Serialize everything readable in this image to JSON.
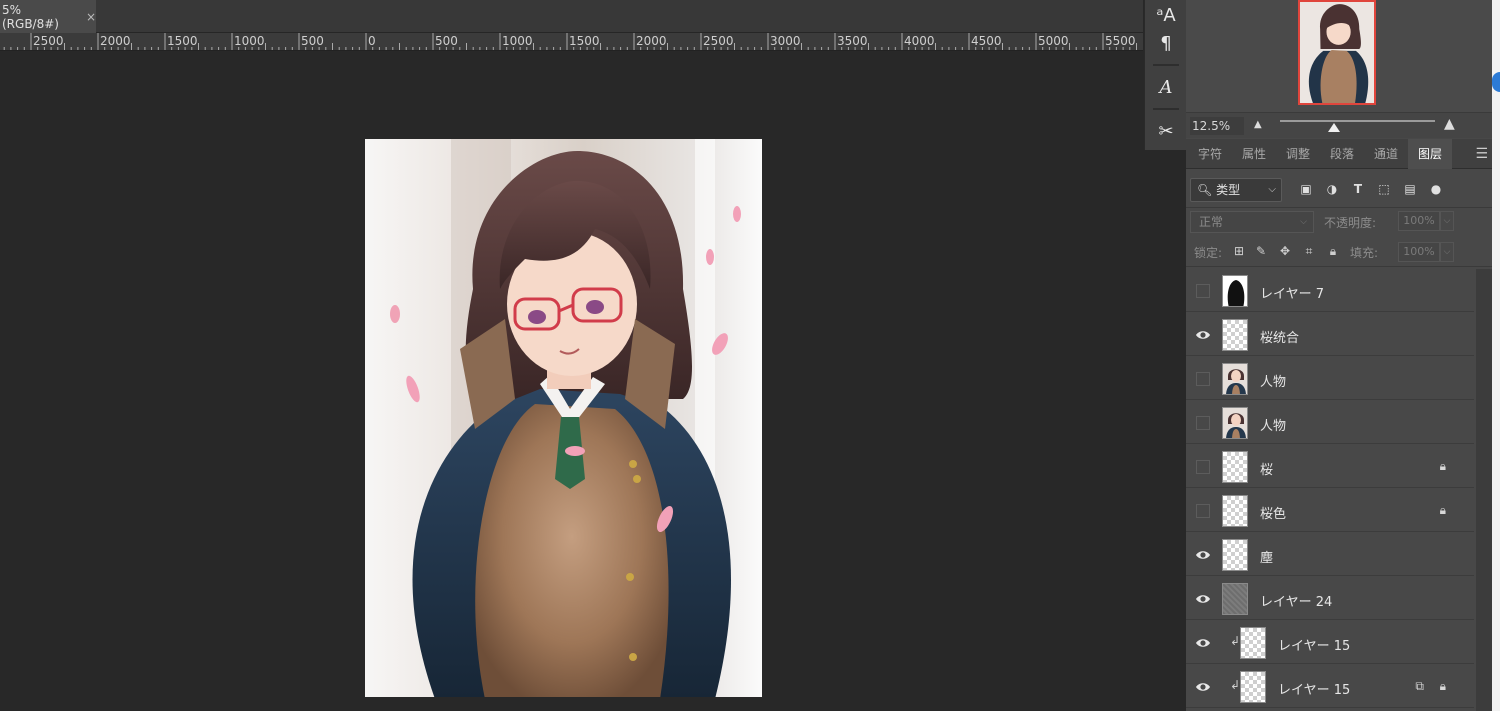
{
  "document": {
    "tab_title": "5%(RGB/8#)",
    "close_glyph": "×"
  },
  "ruler": {
    "labels": [
      "2500",
      "2000",
      "1500",
      "1000",
      "500",
      "0",
      "500",
      "1000",
      "1500",
      "2000",
      "2500",
      "3000",
      "3500",
      "4000",
      "4500",
      "5000",
      "5500"
    ]
  },
  "toolstrip": {
    "tools": [
      {
        "name": "character-styles-icon",
        "glyph": "ᵃA"
      },
      {
        "name": "paragraph-styles-icon",
        "glyph": "¶"
      },
      {
        "name": "glyphs-icon",
        "glyph": "A"
      },
      {
        "name": "tool-presets-icon",
        "glyph": "✂"
      }
    ]
  },
  "navigator": {
    "zoom": "12.5%",
    "zoom_fraction": 0.35
  },
  "tabs": [
    {
      "label": "字符",
      "active": false
    },
    {
      "label": "属性",
      "active": false
    },
    {
      "label": "调整",
      "active": false
    },
    {
      "label": "段落",
      "active": false
    },
    {
      "label": "通道",
      "active": false
    },
    {
      "label": "图层",
      "active": true
    }
  ],
  "filter": {
    "kind": "类型"
  },
  "blend": {
    "mode": "正常",
    "opacity_label": "不透明度:",
    "opacity": "100%"
  },
  "lock": {
    "label": "锁定:",
    "fill_label": "填充:",
    "fill": "100%"
  },
  "layers": [
    {
      "name": "レイヤー 7",
      "visible": false,
      "thumb": "mask",
      "clipped": false,
      "locked": false,
      "linked": false
    },
    {
      "name": "桜统合",
      "visible": true,
      "thumb": "checker",
      "clipped": false,
      "locked": false,
      "linked": false
    },
    {
      "name": "人物",
      "visible": false,
      "thumb": "figure",
      "clipped": false,
      "locked": false,
      "linked": false
    },
    {
      "name": "人物",
      "visible": false,
      "thumb": "figure",
      "clipped": false,
      "locked": false,
      "linked": false
    },
    {
      "name": "桜",
      "visible": false,
      "thumb": "checker",
      "clipped": false,
      "locked": true,
      "linked": false
    },
    {
      "name": "桜色",
      "visible": false,
      "thumb": "checker",
      "clipped": false,
      "locked": true,
      "linked": false
    },
    {
      "name": "塵",
      "visible": true,
      "thumb": "checker",
      "clipped": false,
      "locked": false,
      "linked": false
    },
    {
      "name": "レイヤー 24",
      "visible": true,
      "thumb": "noise",
      "clipped": false,
      "locked": false,
      "linked": false
    },
    {
      "name": "レイヤー 15",
      "visible": true,
      "thumb": "checker",
      "clipped": true,
      "locked": false,
      "linked": false
    },
    {
      "name": "レイヤー 15",
      "visible": true,
      "thumb": "checker",
      "clipped": true,
      "locked": true,
      "linked": true
    }
  ],
  "colors": {
    "accent_red": "#e0453c",
    "edge_blue": "#2c7bd6"
  }
}
